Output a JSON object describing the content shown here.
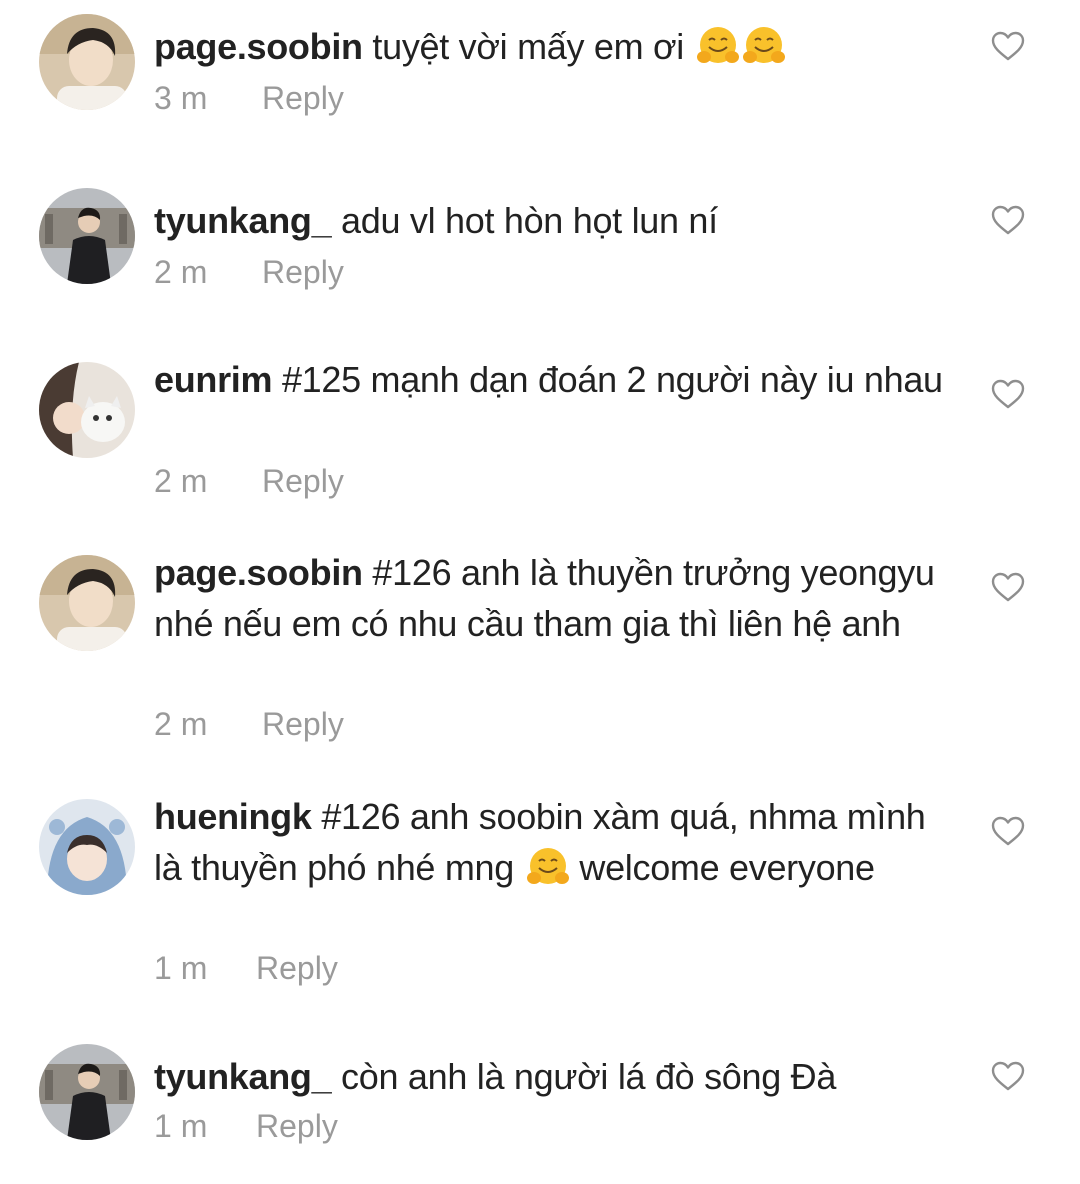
{
  "comments": [
    {
      "username": "page.soobin",
      "text": "tuyệt vời mấy em ơi",
      "emojis": [
        "hugging-face",
        "hugging-face"
      ],
      "time": "3 m",
      "reply_label": "Reply",
      "avatar": "page-soobin-avatar"
    },
    {
      "username": "tyunkang_",
      "text": "adu vl hot hòn họt lun ní",
      "time": "2 m",
      "reply_label": "Reply",
      "avatar": "tyunkang-avatar"
    },
    {
      "username": "eunrim",
      "text": "#125 mạnh dạn đoán 2 người này iu nhau",
      "time": "2 m",
      "reply_label": "Reply",
      "avatar": "eunrim-avatar"
    },
    {
      "username": "page.soobin",
      "text": "#126 anh là thuyền trưởng yeongyu nhé nếu em có nhu cầu tham gia thì liên hệ anh",
      "time": "2 m",
      "reply_label": "Reply",
      "avatar": "page-soobin-avatar"
    },
    {
      "username": "hueningk",
      "text": "#126 anh soobin xàm quá, nhma mình là thuyền phó nhé mng",
      "text_after_emoji": "welcome everyone",
      "emojis": [
        "hugging-face"
      ],
      "time": "1 m",
      "reply_label": "Reply",
      "avatar": "hueningk-avatar"
    },
    {
      "username": "tyunkang_",
      "text": "còn anh là người lá đò sông Đà",
      "time": "1 m",
      "reply_label": "Reply",
      "avatar": "tyunkang-avatar"
    }
  ],
  "icons": {
    "like": "heart-outline-icon",
    "emoji": "hugging-face-emoji"
  },
  "colors": {
    "text": "#222222",
    "meta": "#9a9a9a",
    "heart_stroke": "#8e8e8e",
    "emoji_yellow": "#f9c12b"
  }
}
